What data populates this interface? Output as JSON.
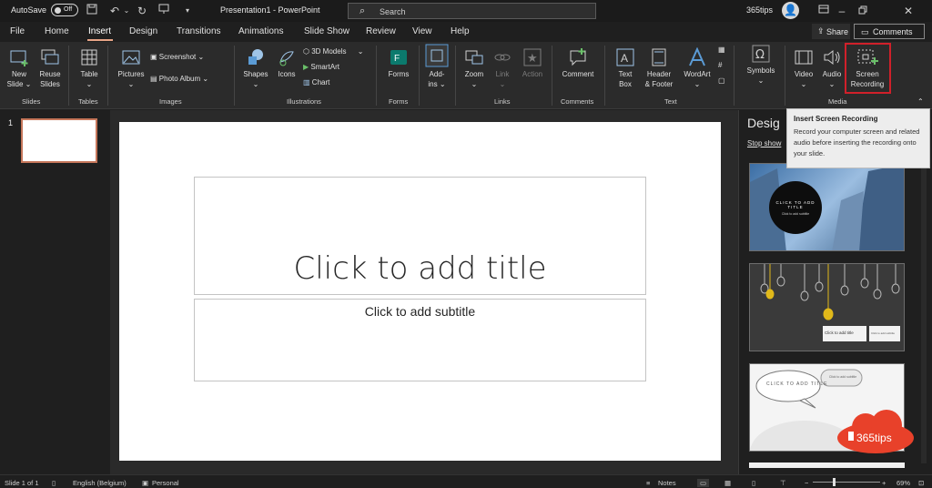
{
  "titlebar": {
    "autosave_label": "AutoSave",
    "autosave_state": "Off",
    "document_title": "Presentation1  -  PowerPoint",
    "search_placeholder": "Search",
    "account_name": "365tips"
  },
  "tabs": [
    {
      "label": "File",
      "active": false
    },
    {
      "label": "Home",
      "active": false
    },
    {
      "label": "Insert",
      "active": true
    },
    {
      "label": "Design",
      "active": false
    },
    {
      "label": "Transitions",
      "active": false
    },
    {
      "label": "Animations",
      "active": false
    },
    {
      "label": "Slide Show",
      "active": false
    },
    {
      "label": "Review",
      "active": false
    },
    {
      "label": "View",
      "active": false
    },
    {
      "label": "Help",
      "active": false
    }
  ],
  "header_buttons": {
    "share": "Share",
    "comments": "Comments"
  },
  "ribbon": {
    "slides": {
      "new_slide": "New",
      "new_slide2": "Slide",
      "reuse": "Reuse",
      "reuse2": "Slides",
      "group": "Slides"
    },
    "tables": {
      "table": "Table",
      "group": "Tables"
    },
    "images": {
      "pictures": "Pictures",
      "screenshot": "Screenshot",
      "photo_album": "Photo Album",
      "group": "Images"
    },
    "illustrations": {
      "shapes": "Shapes",
      "icons": "Icons",
      "models_3d": "3D Models",
      "smartart": "SmartArt",
      "chart": "Chart",
      "group": "Illustrations"
    },
    "forms": {
      "forms": "Forms",
      "group": "Forms"
    },
    "addins": {
      "addins": "Add-",
      "addins2": "ins"
    },
    "links": {
      "zoom": "Zoom",
      "link": "Link",
      "action": "Action",
      "group": "Links"
    },
    "comments": {
      "comment": "Comment",
      "group": "Comments"
    },
    "text": {
      "textbox": "Text",
      "textbox2": "Box",
      "header": "Header",
      "header2": "& Footer",
      "wordart": "WordArt",
      "group": "Text"
    },
    "symbols": {
      "symbols": "Symbols"
    },
    "media": {
      "video": "Video",
      "audio": "Audio",
      "screen": "Screen",
      "screen2": "Recording",
      "group": "Media"
    }
  },
  "tooltip": {
    "title": "Insert Screen Recording",
    "body": "Record your computer screen and related audio before inserting the recording onto your slide."
  },
  "thumbnails": {
    "slide_number": "1"
  },
  "slide": {
    "title_placeholder": "Click to add title",
    "subtitle_placeholder": "Click to add subtitle"
  },
  "designer": {
    "title": "Desig",
    "stop_link": "Stop show",
    "cards": [
      {
        "title_text": "CLICK TO ADD TITLE",
        "subtitle_text": "Click to add subtitle"
      },
      {
        "title_text": "Click to add title",
        "subtitle_text": "Click to add subtitle"
      },
      {
        "title_text": "CLICK TO ADD TITLE",
        "subtitle_text": "Click to add subtitle"
      }
    ],
    "logo_text": "365tips"
  },
  "statusbar": {
    "slide_info": "Slide 1 of 1",
    "language": "English (Belgium)",
    "sensitivity": "Personal",
    "notes": "Notes",
    "zoom": "69%"
  },
  "colors": {
    "accent": "#e8a587",
    "record_highlight": "#d0202a",
    "logo": "#e8412a"
  }
}
